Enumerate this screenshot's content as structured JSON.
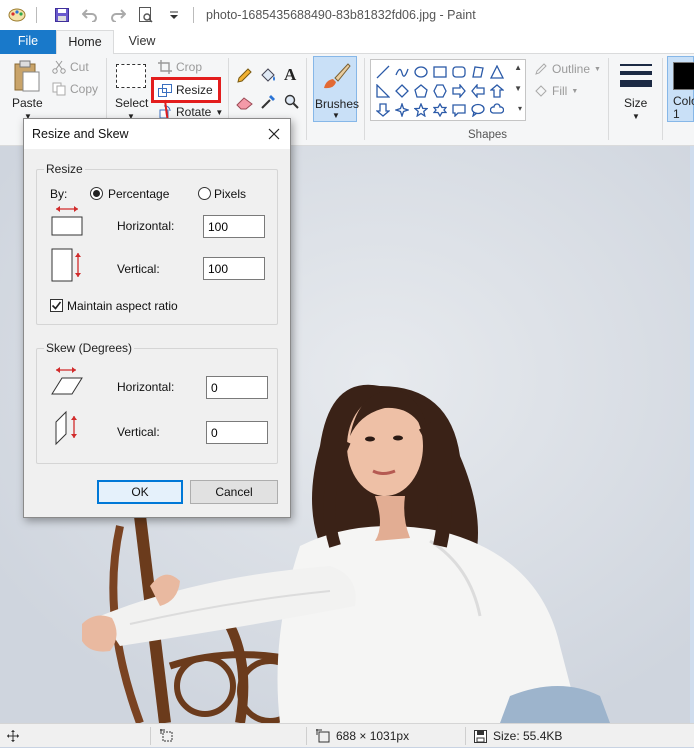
{
  "window": {
    "title": "photo-1685435688490-83b81832fd06.jpg - Paint"
  },
  "tabs": [
    {
      "label": "File"
    },
    {
      "label": "Home"
    },
    {
      "label": "View"
    }
  ],
  "ribbon": {
    "paste_label": "Paste",
    "cut_label": "Cut",
    "copy_label": "Copy",
    "select_label": "Select",
    "crop_label": "Crop",
    "resize_label": "Resize",
    "rotate_label": "Rotate",
    "brushes_label": "Brushes",
    "outline_label": "Outline",
    "fill_label": "Fill",
    "shapes_group_label": "Shapes",
    "size_label": "Size",
    "color1_label": "Colo\n1"
  },
  "dialog": {
    "title": "Resize and Skew",
    "resize_section": "Resize",
    "by_label": "By:",
    "percentage_label": "Percentage",
    "pixels_label": "Pixels",
    "percentage_selected": true,
    "resize_horizontal_label": "Horizontal:",
    "resize_horizontal_value": "100",
    "resize_vertical_label": "Vertical:",
    "resize_vertical_value": "100",
    "maintain_aspect_label": "Maintain aspect ratio",
    "maintain_aspect_checked": true,
    "skew_section": "Skew (Degrees)",
    "skew_horizontal_label": "Horizontal:",
    "skew_horizontal_value": "0",
    "skew_vertical_label": "Vertical:",
    "skew_vertical_value": "0",
    "ok_label": "OK",
    "cancel_label": "Cancel"
  },
  "status": {
    "dimensions": "688 × 1031px",
    "size": "Size: 55.4KB"
  },
  "colors": {
    "accent": "#1979ca",
    "highlight": "#e31d1d"
  }
}
